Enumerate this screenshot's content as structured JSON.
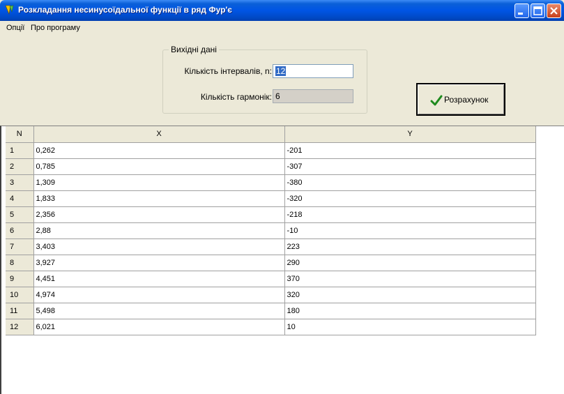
{
  "window": {
    "title": "Розкладання несинусоїдальної функції в ряд Фур'є",
    "controls": [
      "minimize-icon",
      "maximize-icon",
      "close-icon"
    ]
  },
  "menu": {
    "items": [
      "Опції",
      "Про програму"
    ]
  },
  "input_group": {
    "title": "Вихідні дані",
    "intervals_label": "Кількість інтервалів, n:",
    "intervals_value": "12",
    "harmonics_label": "Кількість гармонік:",
    "harmonics_value": "6"
  },
  "calc_button": {
    "label": "Розрахунок",
    "icon": "checkmark-icon"
  },
  "table": {
    "headers": [
      "N",
      "X",
      "Y"
    ],
    "rows": [
      [
        "1",
        "0,262",
        "-201"
      ],
      [
        "2",
        "0,785",
        "-307"
      ],
      [
        "3",
        "1,309",
        "-380"
      ],
      [
        "4",
        "1,833",
        "-320"
      ],
      [
        "5",
        "2,356",
        "-218"
      ],
      [
        "6",
        "2,88",
        "-10"
      ],
      [
        "7",
        "3,403",
        "223"
      ],
      [
        "8",
        "3,927",
        "290"
      ],
      [
        "9",
        "4,451",
        "370"
      ],
      [
        "10",
        "4,974",
        "320"
      ],
      [
        "11",
        "5,498",
        "180"
      ],
      [
        "12",
        "6,021",
        "10"
      ]
    ]
  },
  "colors": {
    "titlebar": "#0055e5",
    "face": "#ece9d8",
    "selection": "#316ac5"
  }
}
